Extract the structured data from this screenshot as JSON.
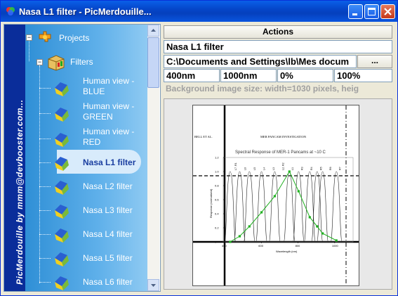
{
  "window": {
    "title": "Nasa L1 filter - PicMerdouille...",
    "controls": [
      "minimize",
      "maximize",
      "close"
    ]
  },
  "sidebar": {
    "vertical_text": "PicMerdouille by mmm@devbooster.com..."
  },
  "tree": {
    "root": {
      "label": "Projects",
      "icon": "gear-puzzle-icon"
    },
    "folder": {
      "label": "Filters",
      "icon": "box-icon"
    },
    "items": [
      {
        "label_line1": "Human view -",
        "label_line2": "BLUE",
        "icon": "cube-icon"
      },
      {
        "label_line1": "Human view -",
        "label_line2": "GREEN",
        "icon": "cube-icon"
      },
      {
        "label_line1": "Human view -",
        "label_line2": "RED",
        "icon": "cube-icon"
      },
      {
        "label_line1": "Nasa L1 filter",
        "label_line2": "",
        "icon": "cube-icon",
        "selected": true
      },
      {
        "label_line1": "Nasa L2 filter",
        "label_line2": "",
        "icon": "cube-icon"
      },
      {
        "label_line1": "Nasa L3 filter",
        "label_line2": "",
        "icon": "cube-icon"
      },
      {
        "label_line1": "Nasa L4 filter",
        "label_line2": "",
        "icon": "cube-icon"
      },
      {
        "label_line1": "Nasa L5 filter",
        "label_line2": "",
        "icon": "cube-icon"
      },
      {
        "label_line1": "Nasa L6 filter",
        "label_line2": "",
        "icon": "cube-icon"
      }
    ]
  },
  "panel": {
    "actions_label": "Actions",
    "name_value": "Nasa L1 filter",
    "path_value": "C:\\Documents and Settings\\lb\\Mes docum",
    "browse_label": "...",
    "range": [
      "400nm",
      "1000nm",
      "0%",
      "100%"
    ],
    "info_text": "Background image size: width=1030 pixels, heig"
  },
  "figure": {
    "left_header": "BELL ET AL.",
    "center_header": "MER PANCAM INVESTIGATION",
    "chart_title": "Spectral Response of MER-1 Pancams at ~10 C",
    "ylabel": "Response (normalized)",
    "xlabel": "Wavelength (nm)",
    "x_ticks": [
      "400",
      "600",
      "800",
      "1000"
    ],
    "y_ticks": [
      "0",
      "0.2",
      "0.4",
      "0.6",
      "0.8",
      "1.0",
      "1.2"
    ],
    "band_labels": [
      "L7, R1",
      "L6",
      "L5",
      "L4",
      "L3",
      "L2, R2",
      "L1",
      "R3",
      "R4",
      "R5",
      "R6",
      "R7"
    ]
  },
  "chart_data": {
    "type": "line",
    "x": [
      430,
      482,
      535,
      601,
      673,
      753,
      803,
      864,
      904,
      934,
      1009
    ],
    "series": [
      {
        "values": [
          0.0,
          0.08,
          0.22,
          0.42,
          0.65,
          1.0,
          0.72,
          0.35,
          0.22,
          0.12,
          0.02
        ]
      }
    ],
    "xlim": [
      400,
      1100
    ],
    "ylim": [
      0,
      1.2
    ],
    "colors": {
      "markers": "#22b022"
    }
  },
  "colors": {
    "accent": "#0a2d9a",
    "titlebar": "#0546c9",
    "tree_text": "#ffffff",
    "selected_text": "#1a3ea0"
  }
}
